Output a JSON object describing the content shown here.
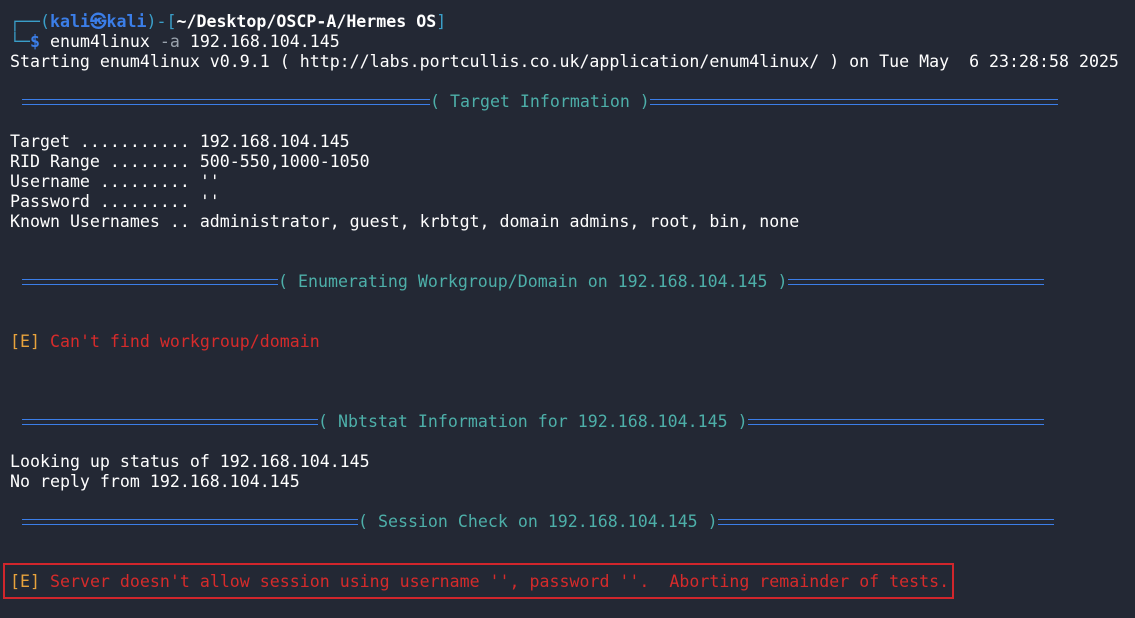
{
  "prompt": {
    "corner_top": "┌──(",
    "user": "kali",
    "at_glyph": "㉿",
    "host": "kali",
    "close_paren": ")-[",
    "path": "~/Desktop/OSCP-A/Hermes OS",
    "close_bracket": "]",
    "corner_bottom": "└─",
    "dollar": "$",
    "command": "enum4linux",
    "flag": "-a",
    "arg": "192.168.104.145"
  },
  "output": {
    "starting": "Starting enum4linux v0.9.1 ( http://labs.portcullis.co.uk/application/enum4linux/ ) on Tue May  6 23:28:58 2025",
    "target_info": {
      "title": "( Target Information )",
      "lines": [
        "Target ........... 192.168.104.145",
        "RID Range ........ 500-550,1000-1050",
        "Username ......... ''",
        "Password ......... ''",
        "Known Usernames .. administrator, guest, krbtgt, domain admins, root, bin, none"
      ]
    },
    "workgroup": {
      "title": "( Enumerating Workgroup/Domain on 192.168.104.145 )",
      "error_tag": "[E]",
      "error_text": "Can't find workgroup/domain"
    },
    "nbtstat": {
      "title": "( Nbtstat Information for 192.168.104.145 )",
      "lines": [
        "Looking up status of 192.168.104.145",
        "No reply from 192.168.104.145"
      ]
    },
    "session": {
      "title": "( Session Check on 192.168.104.145 )",
      "error_tag": "[E]",
      "error_text": "Server doesn't allow session using username '', password ''.  Aborting remainder of tests."
    }
  },
  "colors": {
    "background": "#232834",
    "prompt_blue": "#3b7ee8",
    "section_teal": "#4dafa9",
    "error_red": "#d62b2b",
    "error_tag_orange": "#e8a33c",
    "highlight_box": "#d0262c"
  }
}
